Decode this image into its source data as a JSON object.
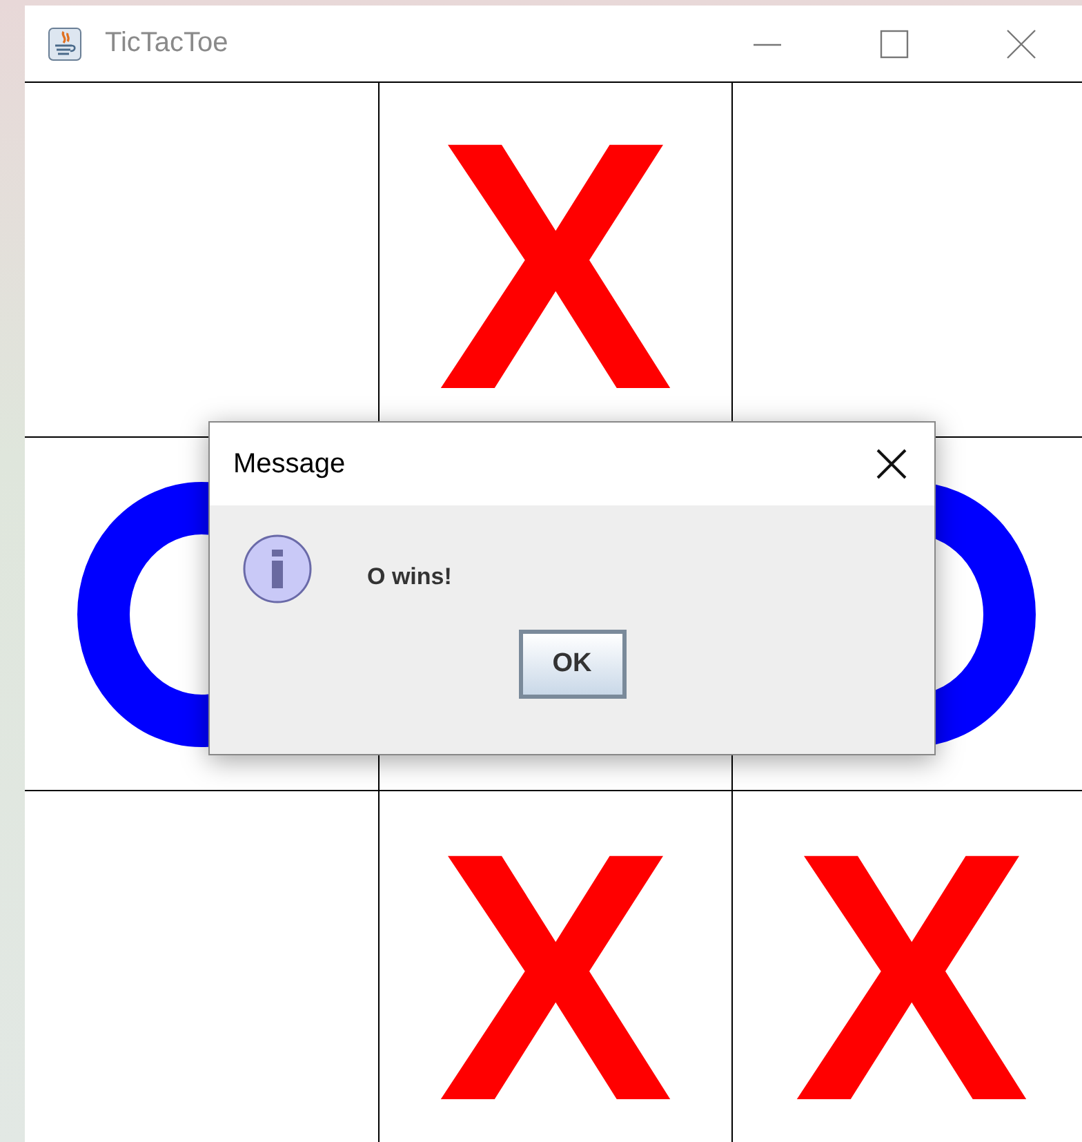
{
  "window": {
    "title": "TicTacToe"
  },
  "board": {
    "cells": [
      {
        "kind": "empty"
      },
      {
        "kind": "x",
        "text": "X"
      },
      {
        "kind": "empty"
      },
      {
        "kind": "o"
      },
      {
        "kind": "hidden"
      },
      {
        "kind": "o"
      },
      {
        "kind": "empty"
      },
      {
        "kind": "x",
        "text": "X"
      },
      {
        "kind": "x",
        "text": "X"
      }
    ]
  },
  "dialog": {
    "title": "Message",
    "message": "O wins!",
    "buttons": [
      "OK"
    ]
  }
}
